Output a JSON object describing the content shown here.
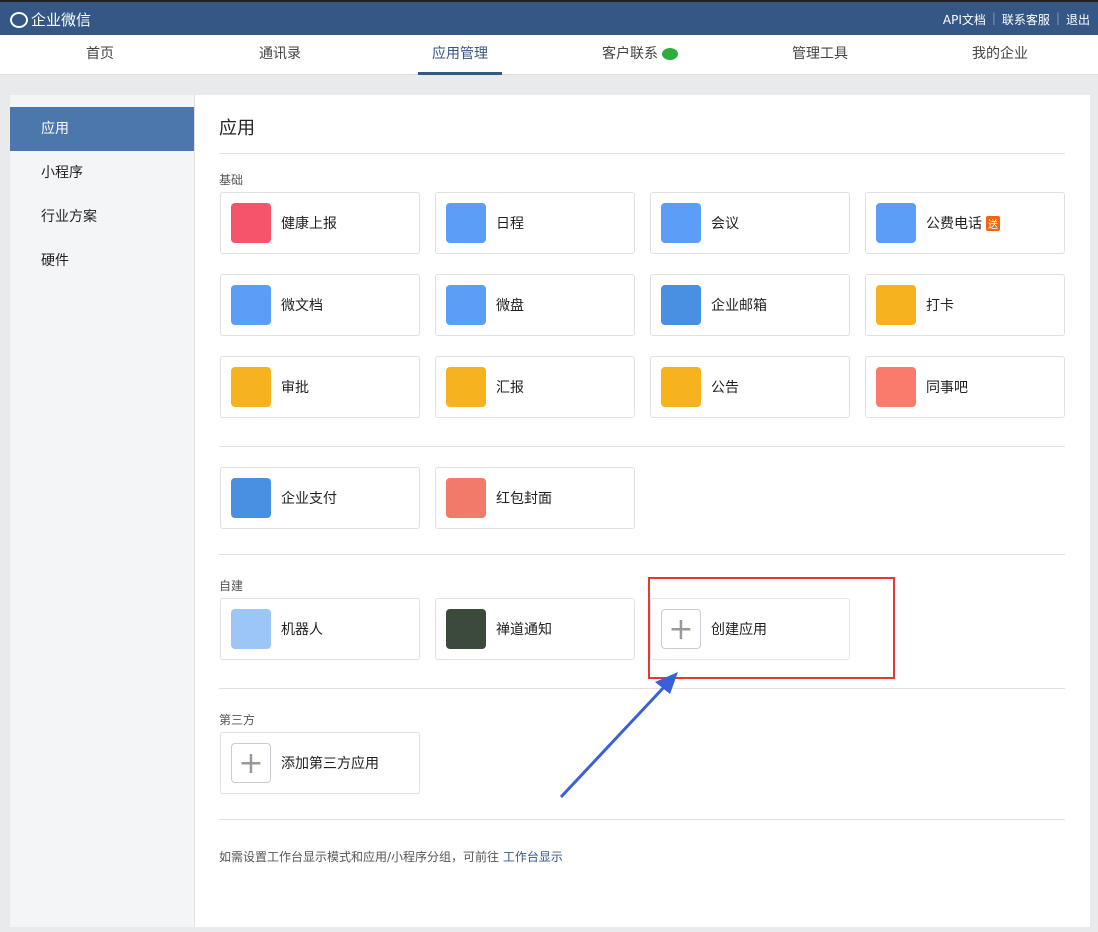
{
  "topbar": {
    "brand": "企业微信",
    "links": [
      "API文档",
      "联系客服",
      "退出"
    ]
  },
  "nav": {
    "tabs": [
      "首页",
      "通讯录",
      "应用管理",
      "客户联系",
      "管理工具",
      "我的企业"
    ],
    "active": "应用管理"
  },
  "sidebar": {
    "items": [
      "应用",
      "小程序",
      "行业方案",
      "硬件"
    ],
    "active": "应用"
  },
  "main": {
    "title": "应用",
    "basic_label": "基础",
    "basic_apps": [
      {
        "name": "健康上报",
        "icon": "health-report-icon",
        "color": "#f5546a"
      },
      {
        "name": "日程",
        "icon": "calendar-icon",
        "color": "#5a9ef8"
      },
      {
        "name": "会议",
        "icon": "meeting-icon",
        "color": "#5a9ef8"
      },
      {
        "name": "公费电话",
        "icon": "phone-icon",
        "color": "#5a9ef8",
        "badge": "送"
      },
      {
        "name": "微文档",
        "icon": "doc-icon",
        "color": "#5a9ef8"
      },
      {
        "name": "微盘",
        "icon": "drive-icon",
        "color": "#5a9ef8"
      },
      {
        "name": "企业邮箱",
        "icon": "mail-icon",
        "color": "#4a90e2"
      },
      {
        "name": "打卡",
        "icon": "location-icon",
        "color": "#f6b31d"
      },
      {
        "name": "审批",
        "icon": "stamp-icon",
        "color": "#f6b31d"
      },
      {
        "name": "汇报",
        "icon": "report-icon",
        "color": "#f6b31d"
      },
      {
        "name": "公告",
        "icon": "megaphone-icon",
        "color": "#f6b31d"
      },
      {
        "name": "同事吧",
        "icon": "colleague-icon",
        "color": "#fa7a6c"
      }
    ],
    "pay_apps": [
      {
        "name": "企业支付",
        "icon": "pay-icon",
        "color": "#4a90e2"
      },
      {
        "name": "红包封面",
        "icon": "red-envelope-icon",
        "color": "#f17a6a"
      }
    ],
    "custom_label": "自建",
    "custom_apps": [
      {
        "name": "机器人",
        "icon": "robot-icon",
        "color": "#9cc6f5"
      },
      {
        "name": "禅道通知",
        "icon": "panda-icon",
        "color": "#3b4a3a"
      }
    ],
    "create_app": "创建应用",
    "third_label": "第三方",
    "add_third": "添加第三方应用",
    "footer_text": "如需设置工作台显示模式和应用/小程序分组，可前往",
    "footer_link": "工作台显示"
  }
}
